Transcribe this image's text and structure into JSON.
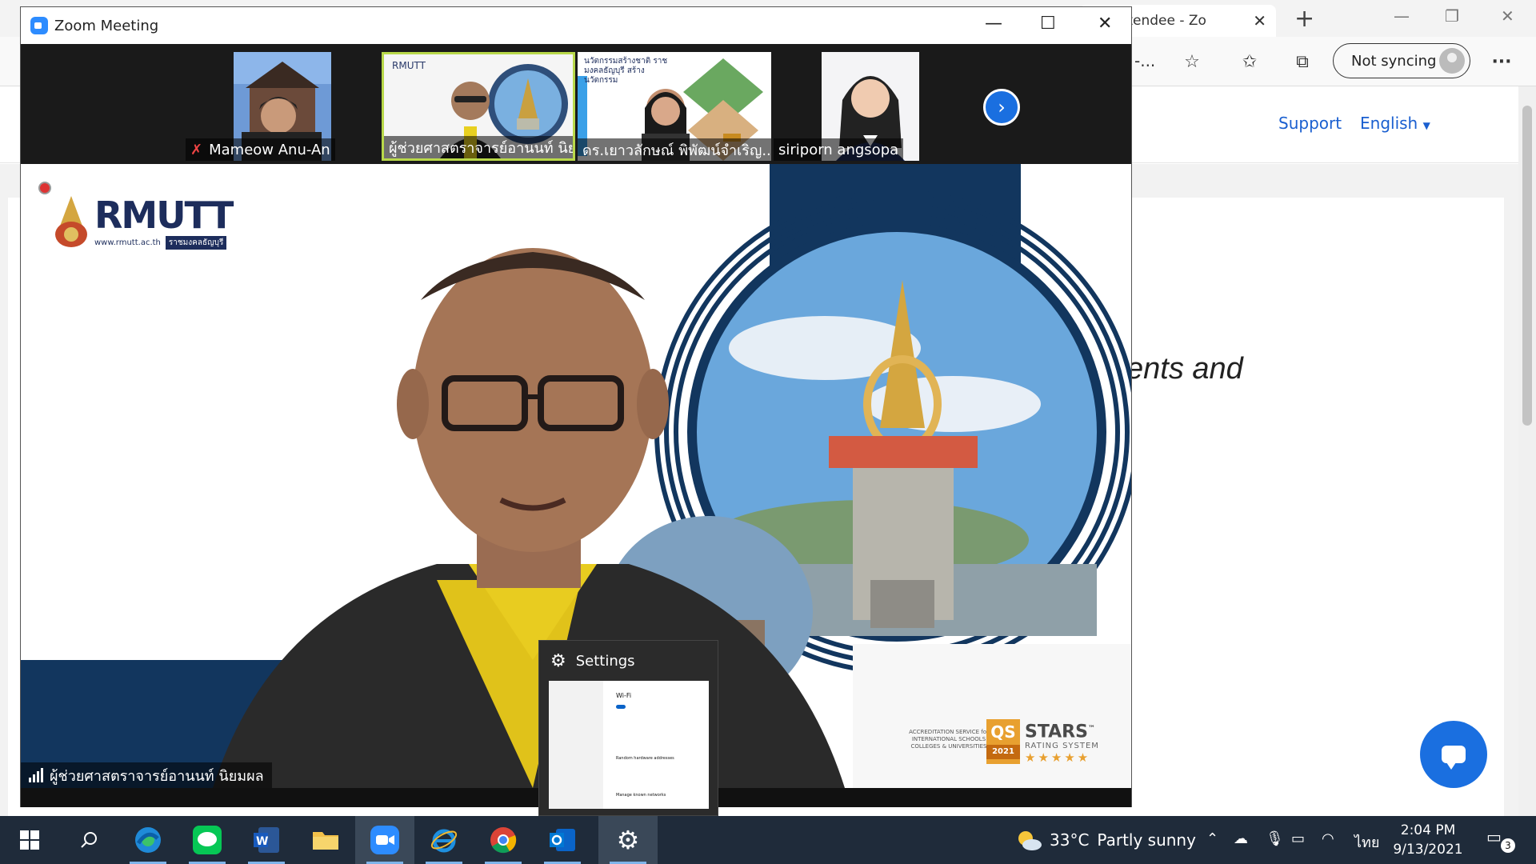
{
  "edge": {
    "tab_title": "ost Attendee - Zo",
    "address_fragment": "-...",
    "sync_label": "Not syncing",
    "menu_label": "···"
  },
  "site": {
    "nav": {
      "support": "Support",
      "language": "English"
    },
    "headline_fragment": "ents and"
  },
  "zoom": {
    "title": "Zoom Meeting",
    "participants": [
      {
        "name": "Mameow Anu-An",
        "muted": true
      },
      {
        "name": "ผู้ช่วยศาสตราจารย์อานนท์ นิย...",
        "active": true
      },
      {
        "name": "ดร.เยาวลักษณ์ พิพัฒน์จำเริญ..."
      },
      {
        "name": "siriporn angsopa"
      }
    ],
    "speaker_name": "ผู้ช่วยศาสตราจารย์อานนท์ นิยมผล",
    "slide": {
      "logo_text": "RMUTT",
      "logo_sub": "www.rmutt.ac.th",
      "logo_tag": "ราชมงคลธัญบุรี",
      "thumb_banner": "นวัตกรรมสร้างชาติ ราชมงคลธัญบุรี สร้างนวัตกรรม",
      "accreditation": "ACCREDITATION SERVICE for INTERNATIONAL SCHOOLS COLLEGES & UNIVERSITIES",
      "qs_title": "STARS",
      "qs_sub": "RATING SYSTEM",
      "qs_year": "2021",
      "qs_tm": "™",
      "qs_badge": "QS"
    }
  },
  "settings_popup": {
    "title": "Settings",
    "preview_heading": "Wi-Fi",
    "preview_sub": "Random hardware addresses",
    "preview_foot": "Manage known networks"
  },
  "taskbar": {
    "weather_temp": "33°C",
    "weather_text": "Partly sunny",
    "language": "ไทย",
    "time": "2:04 PM",
    "date": "9/13/2021",
    "notifications": "3"
  },
  "colors": {
    "zoom_blue": "#2d8cff",
    "edge_link": "#1a5fd0",
    "taskbar": "#1f2b3a",
    "active_border": "#b8d84a"
  }
}
